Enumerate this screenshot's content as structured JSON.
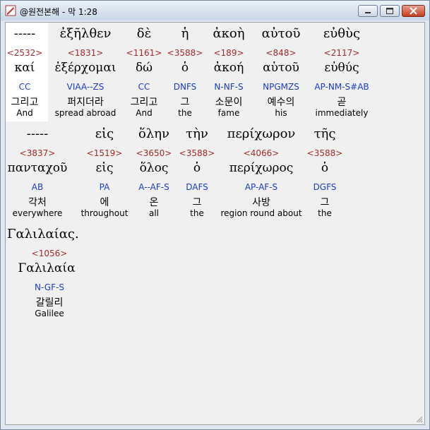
{
  "window": {
    "title": "@원전본해 - 막 1:28"
  },
  "lines": [
    {
      "words": [
        {
          "greek": "-----",
          "strong": "<2532>",
          "lemma": "καί",
          "morph": "CC",
          "korean": "그리고",
          "english": "And"
        },
        {
          "greek": "ἐξῆλθεν",
          "strong": "<1831>",
          "lemma": "ἐξέρχομαι",
          "morph": "VIAA--ZS",
          "korean": "퍼지더라",
          "english": "spread abroad"
        },
        {
          "greek": "δὲ",
          "strong": "<1161>",
          "lemma": "δώ",
          "morph": "CC",
          "korean": "그리고",
          "english": "And"
        },
        {
          "greek": "ἡ",
          "strong": "<3588>",
          "lemma": "ὁ",
          "morph": "DNFS",
          "korean": "그",
          "english": "the"
        },
        {
          "greek": "ἀκοὴ",
          "strong": "<189>",
          "lemma": "ἀκοή",
          "morph": "N-NF-S",
          "korean": "소문이",
          "english": "fame"
        },
        {
          "greek": "αὐτοῦ",
          "strong": "<848>",
          "lemma": "αὑτοῦ",
          "morph": "NPGMZS",
          "korean": "예수의",
          "english": "his"
        },
        {
          "greek": "εὐθὺς",
          "strong": "<2117>",
          "lemma": "εὐθύς",
          "morph": "AP-NM-S#AB",
          "korean": "곧",
          "english": "immediately"
        }
      ]
    },
    {
      "words": [
        {
          "greek": "-----",
          "strong": "<3837>",
          "lemma": "πανταχοῦ",
          "morph": "AB",
          "korean": "각처",
          "english": "everywhere"
        },
        {
          "greek": "εἰς",
          "strong": "<1519>",
          "lemma": "εἰς",
          "morph": "PA",
          "korean": "에",
          "english": "throughout"
        },
        {
          "greek": "ὅλην",
          "strong": "<3650>",
          "lemma": "ὅλος",
          "morph": "A--AF-S",
          "korean": "온",
          "english": "all"
        },
        {
          "greek": "τὴν",
          "strong": "<3588>",
          "lemma": "ὁ",
          "morph": "DAFS",
          "korean": "그",
          "english": "the"
        },
        {
          "greek": "περίχωρον",
          "strong": "<4066>",
          "lemma": "περίχωρος",
          "morph": "AP-AF-S",
          "korean": "사방",
          "english": "region round about"
        },
        {
          "greek": "τῆς",
          "strong": "<3588>",
          "lemma": "ὁ",
          "morph": "DGFS",
          "korean": "그",
          "english": "the"
        }
      ]
    },
    {
      "words": [
        {
          "greek": "Γαλιλαίας.",
          "strong": "<1056>",
          "lemma": "Γαλιλαία",
          "morph": "N-GF-S",
          "korean": "갈릴리",
          "english": "Galilee"
        }
      ]
    }
  ],
  "colors": {
    "strong": "#a52a2a",
    "morph": "#1c3cc8",
    "text": "#000000",
    "background": "#f0f0f0",
    "selected": "#ffffff"
  },
  "icons": {
    "app": "app-logo-icon",
    "minimize": "minimize-icon",
    "maximize": "maximize-icon",
    "close": "close-icon"
  }
}
